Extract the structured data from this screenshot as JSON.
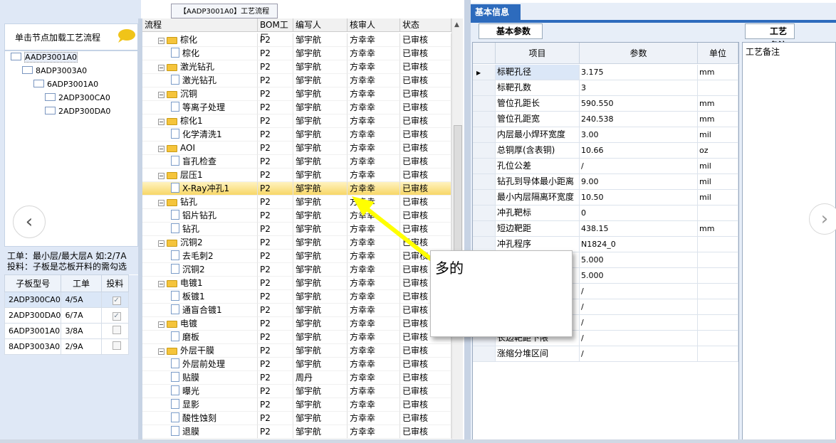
{
  "left": {
    "hint": "单击节点加载工艺流程",
    "tree": [
      {
        "label": "AADP3001A0",
        "depth": 0
      },
      {
        "label": "8ADP3003A0",
        "depth": 1
      },
      {
        "label": "6ADP3001A0",
        "depth": 2
      },
      {
        "label": "2ADP300CA0",
        "depth": 3
      },
      {
        "label": "2ADP300DA0",
        "depth": 3
      }
    ],
    "info_line1": "工单：最小层/最大层A 如:2/7A",
    "info_line2": "投料：子板是芯板开料的需勾选",
    "table_headers": [
      "子板型号",
      "工单",
      "投料"
    ],
    "table_rows": [
      {
        "model": "2ADP300CA0",
        "order": "4/5A",
        "checked": true
      },
      {
        "model": "2ADP300DA0",
        "order": "6/7A",
        "checked": true
      },
      {
        "model": "6ADP3001A0",
        "order": "3/8A",
        "checked": false
      },
      {
        "model": "8ADP3003A0",
        "order": "2/9A",
        "checked": false
      }
    ]
  },
  "middle": {
    "title": "【AADP3001A0】工艺流程",
    "headers": [
      "流程",
      "BOM工厂",
      "编写人",
      "核审人",
      "状态"
    ],
    "rows": [
      {
        "name": "棕化",
        "type": "folder",
        "factory": "P2",
        "writer": "邹宇航",
        "reviewer": "方幸幸",
        "status": "已审核"
      },
      {
        "name": "棕化",
        "type": "doc",
        "factory": "P2",
        "writer": "邹宇航",
        "reviewer": "方幸幸",
        "status": "已审核"
      },
      {
        "name": "激光钻孔",
        "type": "folder",
        "factory": "P2",
        "writer": "邹宇航",
        "reviewer": "方幸幸",
        "status": "已审核"
      },
      {
        "name": "激光钻孔",
        "type": "doc",
        "factory": "P2",
        "writer": "邹宇航",
        "reviewer": "方幸幸",
        "status": "已审核"
      },
      {
        "name": "沉铜",
        "type": "folder",
        "factory": "P2",
        "writer": "邹宇航",
        "reviewer": "方幸幸",
        "status": "已审核"
      },
      {
        "name": "等离子处理",
        "type": "doc",
        "factory": "P2",
        "writer": "邹宇航",
        "reviewer": "方幸幸",
        "status": "已审核"
      },
      {
        "name": "棕化1",
        "type": "folder",
        "factory": "P2",
        "writer": "邹宇航",
        "reviewer": "方幸幸",
        "status": "已审核"
      },
      {
        "name": "化学清洗1",
        "type": "doc",
        "factory": "P2",
        "writer": "邹宇航",
        "reviewer": "方幸幸",
        "status": "已审核"
      },
      {
        "name": "AOI",
        "type": "folder",
        "factory": "P2",
        "writer": "邹宇航",
        "reviewer": "方幸幸",
        "status": "已审核"
      },
      {
        "name": "盲孔检查",
        "type": "doc",
        "factory": "P2",
        "writer": "邹宇航",
        "reviewer": "方幸幸",
        "status": "已审核"
      },
      {
        "name": "层压1",
        "type": "folder",
        "factory": "P2",
        "writer": "邹宇航",
        "reviewer": "方幸幸",
        "status": "已审核"
      },
      {
        "name": "X-Ray冲孔1",
        "type": "doc",
        "factory": "P2",
        "writer": "邹宇航",
        "reviewer": "方幸幸",
        "status": "已审核",
        "highlight": true
      },
      {
        "name": "钻孔",
        "type": "folder",
        "factory": "P2",
        "writer": "邹宇航",
        "reviewer": "方幸幸",
        "status": "已审核"
      },
      {
        "name": "铝片钻孔",
        "type": "doc",
        "factory": "P2",
        "writer": "邹宇航",
        "reviewer": "方幸幸",
        "status": "已审核"
      },
      {
        "name": "钻孔",
        "type": "doc",
        "factory": "P2",
        "writer": "邹宇航",
        "reviewer": "方幸幸",
        "status": "已审核"
      },
      {
        "name": "沉铜2",
        "type": "folder",
        "factory": "P2",
        "writer": "邹宇航",
        "reviewer": "方幸幸",
        "status": "已审核"
      },
      {
        "name": "去毛刺2",
        "type": "doc",
        "factory": "P2",
        "writer": "邹宇航",
        "reviewer": "方幸幸",
        "status": "已审核"
      },
      {
        "name": "沉铜2",
        "type": "doc",
        "factory": "P2",
        "writer": "邹宇航",
        "reviewer": "方幸幸",
        "status": "已审核"
      },
      {
        "name": "电镀1",
        "type": "folder",
        "factory": "P2",
        "writer": "邹宇航",
        "reviewer": "方幸幸",
        "status": "已审核"
      },
      {
        "name": "板镀1",
        "type": "doc",
        "factory": "P2",
        "writer": "邹宇航",
        "reviewer": "方幸幸",
        "status": "已审核"
      },
      {
        "name": "通盲合镀1",
        "type": "doc",
        "factory": "P2",
        "writer": "邹宇航",
        "reviewer": "方幸幸",
        "status": "已审核"
      },
      {
        "name": "电镀",
        "type": "folder",
        "factory": "P2",
        "writer": "邹宇航",
        "reviewer": "方幸幸",
        "status": "已审核"
      },
      {
        "name": "磨板",
        "type": "doc",
        "factory": "P2",
        "writer": "邹宇航",
        "reviewer": "方幸幸",
        "status": "已审核"
      },
      {
        "name": "外层干膜",
        "type": "folder",
        "factory": "P2",
        "writer": "邹宇航",
        "reviewer": "方幸幸",
        "status": "已审核"
      },
      {
        "name": "外层前处理",
        "type": "doc",
        "factory": "P2",
        "writer": "邹宇航",
        "reviewer": "方幸幸",
        "status": "已审核"
      },
      {
        "name": "贴膜",
        "type": "doc",
        "factory": "P2",
        "writer": "周丹",
        "reviewer": "方幸幸",
        "status": "已审核"
      },
      {
        "name": "曝光",
        "type": "doc",
        "factory": "P2",
        "writer": "邹宇航",
        "reviewer": "方幸幸",
        "status": "已审核"
      },
      {
        "name": "显影",
        "type": "doc",
        "factory": "P2",
        "writer": "邹宇航",
        "reviewer": "方幸幸",
        "status": "已审核"
      },
      {
        "name": "酸性蚀刻",
        "type": "doc",
        "factory": "P2",
        "writer": "邹宇航",
        "reviewer": "方幸幸",
        "status": "已审核"
      },
      {
        "name": "退膜",
        "type": "doc",
        "factory": "P2",
        "writer": "邹宇航",
        "reviewer": "方幸幸",
        "status": "已审核"
      }
    ]
  },
  "right": {
    "tab_basic": "基本信息",
    "tab_params": "基本参数",
    "tab_memo": "工艺备注",
    "memo_label": "工艺备注",
    "headers": [
      "项目",
      "参数",
      "单位"
    ],
    "rows": [
      {
        "item": "标靶孔径",
        "value": "3.175",
        "unit": "mm"
      },
      {
        "item": "标靶孔数",
        "value": "3",
        "unit": ""
      },
      {
        "item": "管位孔距长",
        "value": "590.550",
        "unit": "mm"
      },
      {
        "item": "管位孔距宽",
        "value": "240.538",
        "unit": "mm"
      },
      {
        "item": "内层最小焊环宽度",
        "value": "3.00",
        "unit": "mil"
      },
      {
        "item": "总铜厚(含表铜)",
        "value": "10.66",
        "unit": "oz"
      },
      {
        "item": "孔位公差",
        "value": "/",
        "unit": "mil"
      },
      {
        "item": "钻孔到导体最小距离",
        "value": "9.00",
        "unit": "mil"
      },
      {
        "item": "最小内层隔离环宽度",
        "value": "10.50",
        "unit": "mil"
      },
      {
        "item": "冲孔靶标",
        "value": "0",
        "unit": ""
      },
      {
        "item": "短边靶距",
        "value": "438.15",
        "unit": "mm"
      },
      {
        "item": "冲孔程序",
        "value": "N1824_0",
        "unit": ""
      },
      {
        "item": "",
        "value": "5.000",
        "unit": ""
      },
      {
        "item": "",
        "value": "5.000",
        "unit": ""
      },
      {
        "item": "",
        "value": "/",
        "unit": ""
      },
      {
        "item": "",
        "value": "/",
        "unit": ""
      },
      {
        "item": "",
        "value": "/",
        "unit": ""
      },
      {
        "item": "长边靶距下限",
        "value": "/",
        "unit": ""
      },
      {
        "item": "涨缩分堆区间",
        "value": "/",
        "unit": ""
      }
    ]
  },
  "annotation": {
    "text": "多的",
    "arrow_color": "#ffff00"
  }
}
